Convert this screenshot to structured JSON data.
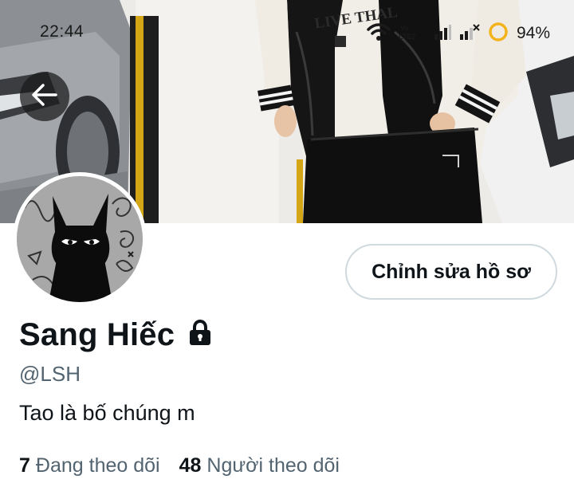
{
  "status_bar": {
    "time": "22:44",
    "battery_percent": "94%",
    "icons": [
      "wifi-icon",
      "volte-icon",
      "signal-icon",
      "signal-icon",
      "battery-ring-icon"
    ]
  },
  "navigation": {
    "back_icon": "arrow-left-icon"
  },
  "profile": {
    "display_name": "Sang Hiếc",
    "protected_icon": "lock-icon",
    "handle": "@LSH",
    "bio": "Tao là bố chúng m",
    "edit_button_label": "Chỉnh sửa hồ sơ",
    "following_count": "7",
    "following_label": "Đang theo dõi",
    "followers_count": "48",
    "followers_label": "Người theo dõi"
  },
  "banner_shirt_text": "LIVE THAL",
  "colors": {
    "text_primary": "#0f1419",
    "text_secondary": "#536471",
    "button_border": "#cfd9de",
    "battery_ring": "#f2b31c"
  }
}
